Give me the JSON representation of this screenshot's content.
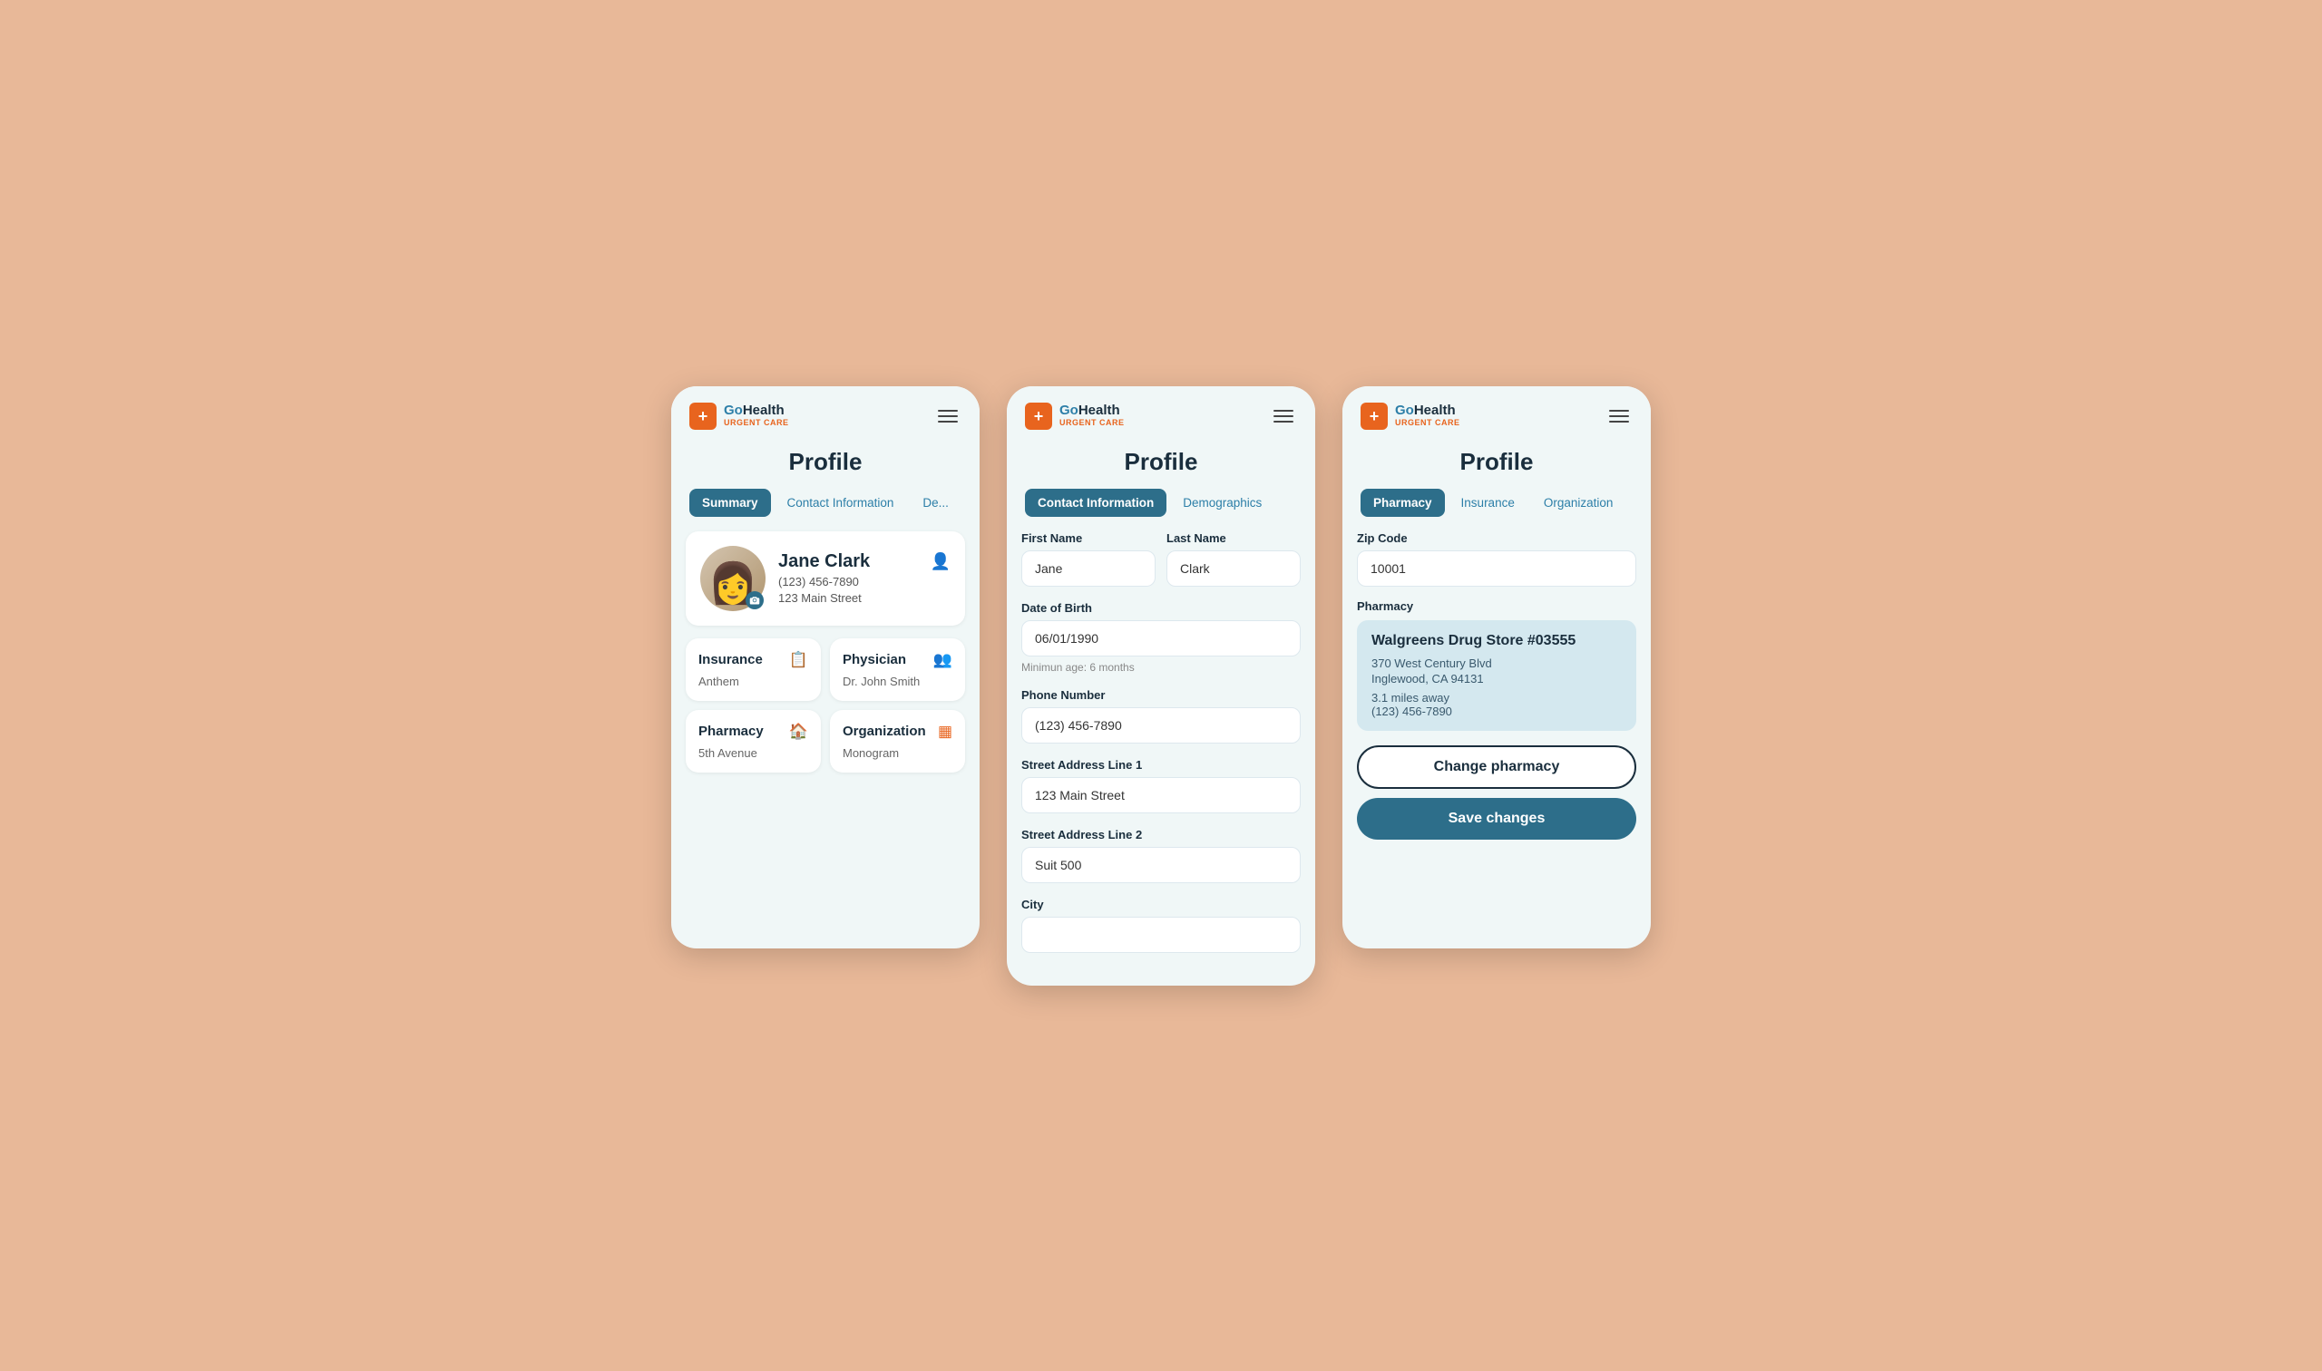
{
  "brand": {
    "go_text": "Go",
    "health_text": "Health",
    "urgent_text": "URGENT CARE"
  },
  "screen1": {
    "title": "Profile",
    "tabs": [
      {
        "label": "Summary",
        "active": true
      },
      {
        "label": "Contact Information",
        "active": false
      },
      {
        "label": "De...",
        "active": false
      }
    ],
    "profile": {
      "name": "Jane Clark",
      "phone": "(123) 456-7890",
      "address": "123 Main Street"
    },
    "cards": [
      {
        "label": "Insurance",
        "value": "Anthem",
        "icon": "📋"
      },
      {
        "label": "Physician",
        "value": "Dr. John Smith",
        "icon": "👥"
      },
      {
        "label": "Pharmacy",
        "value": "5th Avenue",
        "icon": "🏠"
      },
      {
        "label": "Organization",
        "value": "Monogram",
        "icon": "▦"
      }
    ]
  },
  "screen2": {
    "title": "Profile",
    "tabs": [
      {
        "label": "Contact Information",
        "active": true
      },
      {
        "label": "Demographics",
        "active": false
      }
    ],
    "form": {
      "first_name_label": "First Name",
      "first_name_value": "Jane",
      "last_name_label": "Last Name",
      "last_name_value": "Clark",
      "dob_label": "Date of Birth",
      "dob_value": "06/01/1990",
      "dob_hint": "Minimun age: 6 months",
      "phone_label": "Phone Number",
      "phone_value": "(123) 456-7890",
      "address1_label": "Street Address Line 1",
      "address1_value": "123 Main Street",
      "address2_label": "Street Address Line 2",
      "address2_value": "Suit 500",
      "city_label": "City"
    }
  },
  "screen3": {
    "title": "Profile",
    "tabs": [
      {
        "label": "Pharmacy",
        "active": true
      },
      {
        "label": "Insurance",
        "active": false
      },
      {
        "label": "Organization",
        "active": false
      }
    ],
    "zip_label": "Zip Code",
    "zip_value": "10001",
    "pharmacy_label": "Pharmacy",
    "pharmacy": {
      "name": "Walgreens Drug Store #03555",
      "address1": "370 West Century Blvd",
      "address2": "Inglewood, CA 94131",
      "miles": "3.1 miles away",
      "phone": "(123) 456-7890"
    },
    "change_pharmacy_btn": "Change pharmacy",
    "save_changes_btn": "Save changes"
  }
}
